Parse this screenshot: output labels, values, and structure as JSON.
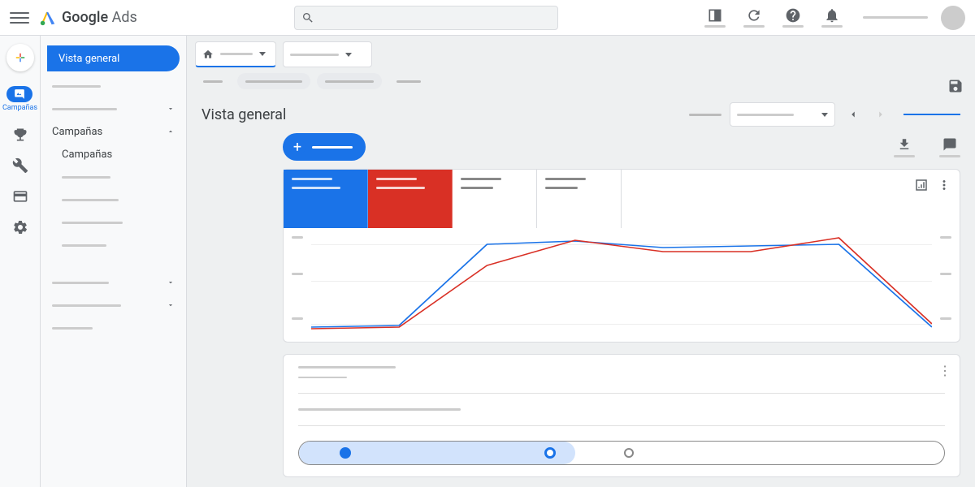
{
  "brand": {
    "name_bold": "Google",
    "name_light": "Ads"
  },
  "iconrail": {
    "campaigns_label": "Campañas"
  },
  "sidebar": {
    "active": "Vista general",
    "section": "Campañas",
    "sub": "Campañas"
  },
  "page": {
    "title": "Vista general"
  },
  "metrics": {
    "colors": [
      "#1a73e8",
      "#d93025",
      "#ffffff",
      "#ffffff"
    ]
  },
  "chart_data": {
    "type": "line",
    "x": [
      0,
      1,
      2,
      3,
      4,
      5,
      6
    ],
    "series": [
      {
        "name": "metric-1",
        "color": "#1a73e8",
        "values": [
          8,
          10,
          92,
          95,
          88,
          90,
          92,
          10
        ]
      },
      {
        "name": "metric-2",
        "color": "#d93025",
        "values": [
          6,
          8,
          70,
          96,
          84,
          84,
          98,
          12
        ]
      }
    ],
    "ylim": [
      0,
      100
    ]
  }
}
